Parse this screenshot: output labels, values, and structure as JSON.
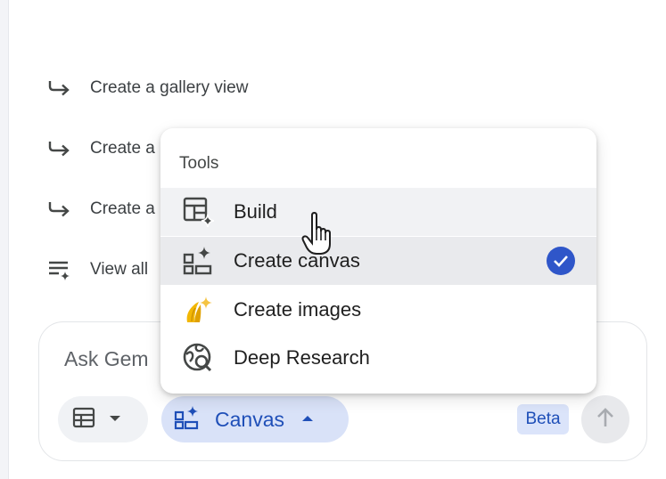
{
  "suggestions": [
    {
      "label": "Create a gallery view",
      "icon": "arrow-return-icon"
    },
    {
      "label": "Create a",
      "icon": "arrow-return-icon"
    },
    {
      "label": "Create a",
      "icon": "arrow-return-icon"
    },
    {
      "label": "View all",
      "icon": "list-sparkle-icon"
    }
  ],
  "composer": {
    "prompt_text": "Ask Gem",
    "canvas_label": "Canvas",
    "beta_label": "Beta"
  },
  "tools_menu": {
    "header": "Tools",
    "items": [
      {
        "label": "Build",
        "icon": "build-grid-sparkle-icon",
        "state": "hover"
      },
      {
        "label": "Create canvas",
        "icon": "canvas-sparkle-icon",
        "state": "selected",
        "checked": true
      },
      {
        "label": "Create images",
        "icon": "banana-sparkle-icon"
      },
      {
        "label": "Deep Research",
        "icon": "globe-search-icon"
      }
    ]
  },
  "colors": {
    "accent": "#2f56c9",
    "chip_active_bg": "#d9e2f8",
    "chip_active_text": "#1f4fb8",
    "menu_selected_bg": "#e9eaed"
  }
}
